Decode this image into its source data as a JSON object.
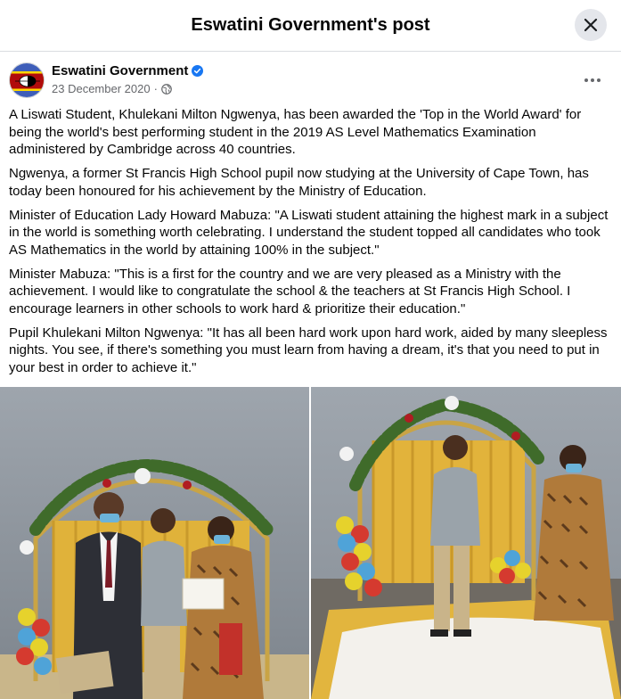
{
  "header": {
    "title": "Eswatini Government's post"
  },
  "post": {
    "author": "Eswatini Government",
    "date": "23 December 2020",
    "date_separator": "·",
    "paragraphs": [
      "A Liswati Student, Khulekani Milton Ngwenya, has been awarded the 'Top in the World Award' for being the world's best performing student in the 2019 AS Level Mathematics Examination administered by Cambridge across 40 countries.",
      "Ngwenya, a former St Francis High School pupil now studying at the University of Cape Town, has today been honoured for his achievement by the Ministry of Education.",
      "Minister of Education Lady Howard Mabuza: \"A Liswati student attaining the highest mark in a subject in the world is something worth celebrating. I understand the student topped all candidates who took AS Mathematics in the world by attaining 100% in the subject.\"",
      "Minister Mabuza: \"This is a first for the country and we are very pleased as a Ministry with the achievement. I would like to congratulate the school & the teachers at St Francis High School. I encourage learners in other schools to work hard & prioritize their education.\"",
      "Pupil Khulekani Milton Ngwenya: \"It has all been hard work upon hard work, aided by many sleepless nights. You see, if there's something you must learn from having a dream, it's that you need to put in your best in order to achieve it.\""
    ]
  },
  "icons": {
    "close": "close-icon",
    "verified": "verified-badge-icon",
    "audience": "globe-icon",
    "more": "more-options-icon"
  },
  "colors": {
    "verified_blue": "#1877f2",
    "secondary_text": "#65676b",
    "close_button_bg": "#e4e6eb",
    "flag_blue": "#3e5eb9",
    "flag_yellow": "#ffd900",
    "flag_red": "#b10c0c"
  }
}
